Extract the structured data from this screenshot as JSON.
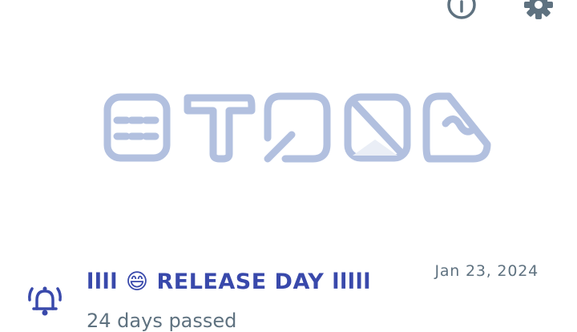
{
  "header": {
    "info_icon": "info-icon",
    "settings_icon": "gear-icon"
  },
  "logo": {
    "glyph_color": "#b2c0df"
  },
  "notification": {
    "icon": "bell-ringing-icon",
    "title": "llll 😄 RELEASE DAY lllll",
    "date": "Jan 23, 2024",
    "subtitle": "24 days passed"
  },
  "colors": {
    "accent": "#3949ab",
    "icon_gray": "#5f7280",
    "logo": "#b2c0df"
  }
}
